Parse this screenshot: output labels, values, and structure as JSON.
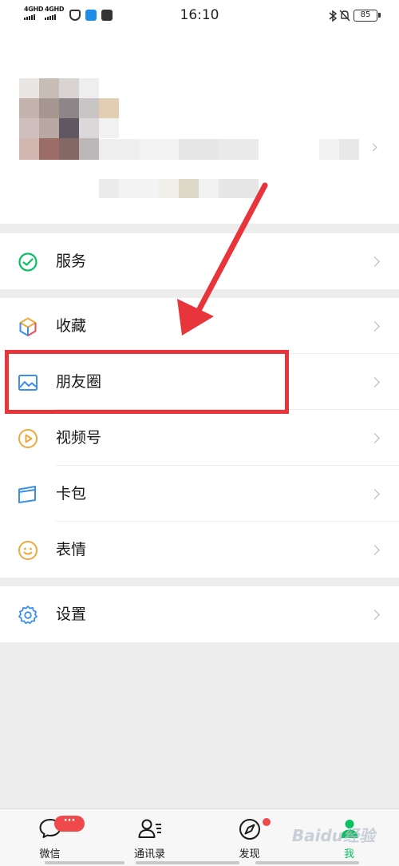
{
  "status_bar": {
    "signal_1": "4GHD",
    "signal_2": "4GHD",
    "time": "16:10",
    "battery": "85"
  },
  "menu": {
    "services": "服务",
    "favorites": "收藏",
    "moments": "朋友圈",
    "channels": "视频号",
    "cards": "卡包",
    "stickers": "表情",
    "settings": "设置"
  },
  "tabs": {
    "chats": "微信",
    "contacts": "通讯录",
    "discover": "发现",
    "me": "我",
    "chats_badge": "···"
  },
  "watermark": "Baidu经验",
  "colors": {
    "accent_green": "#07c160",
    "badge_red": "#f0494b",
    "annotation_red": "#e8353b"
  }
}
